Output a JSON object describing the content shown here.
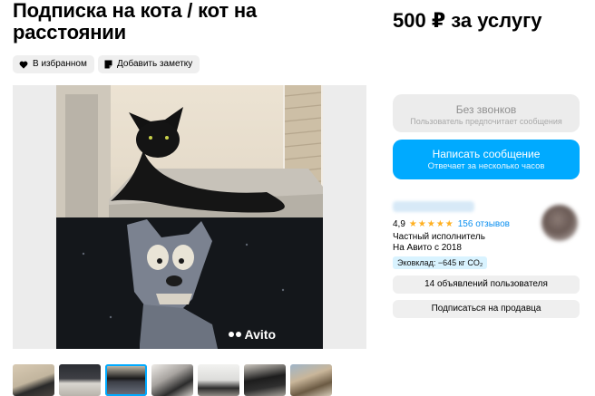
{
  "listing": {
    "title": "Подписка на кота / кот на расстоянии",
    "price": "500 ₽ за услугу"
  },
  "actions": {
    "favorite_label": "В избранном",
    "note_label": "Добавить заметку"
  },
  "gallery": {
    "watermark": "Avito",
    "thumbnail_count": 7,
    "active_thumbnail": 3
  },
  "contact": {
    "no_calls_label": "Без звонков",
    "no_calls_sub": "Пользователь предпочитает сообщения",
    "message_label": "Написать сообщение",
    "message_sub": "Отвечает за несколько часов"
  },
  "seller": {
    "rating": "4,9",
    "stars": 5,
    "reviews": "156 отзывов",
    "type": "Частный исполнитель",
    "since": "На Авито с 2018",
    "eco": "Эковклад: −645 кг CO₂",
    "ads_button": "14 объявлений пользователя",
    "subscribe_button": "Подписаться на продавца"
  },
  "colors": {
    "accent": "#00aaff",
    "link": "#0a8ff0",
    "star": "#ffb021",
    "eco_bg": "#d9f3ff",
    "button_gray": "#efefef"
  }
}
